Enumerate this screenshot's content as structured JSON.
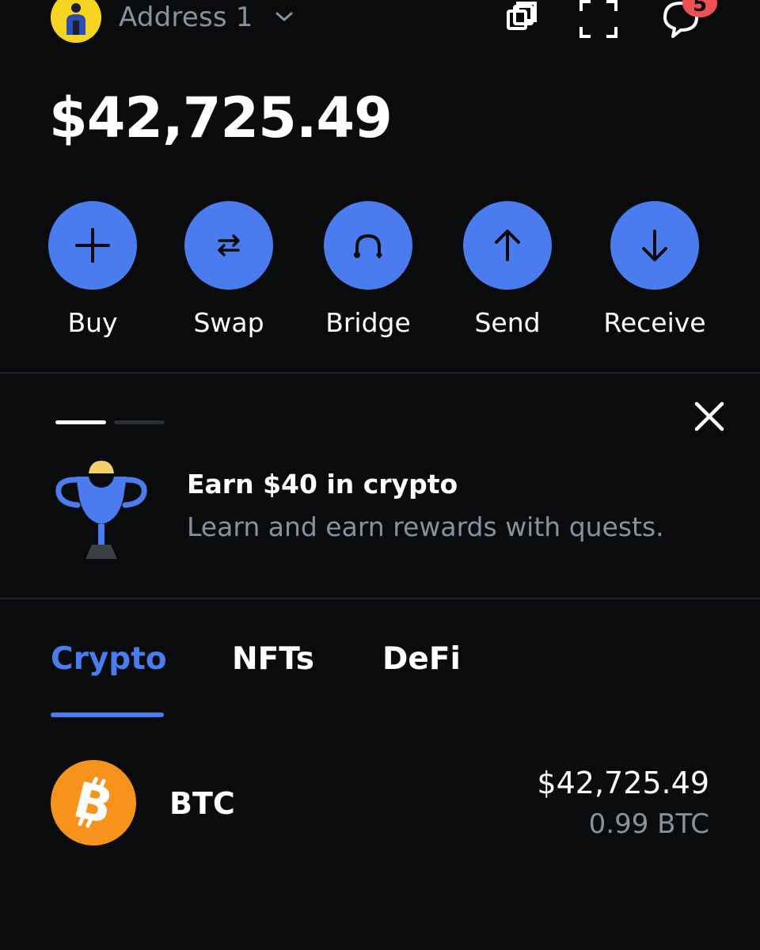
{
  "header": {
    "address_label": "Address 1",
    "avatar_icon": "account-avatar-icon",
    "chevron_icon": "chevron-down-icon",
    "copy_icon": "copy-windows-icon",
    "scan_icon": "qr-scan-icon",
    "messages_icon": "chat-bubble-icon",
    "notification_count": "5",
    "avatar_color": "#f7d322",
    "badge_color": "#f05252"
  },
  "balance": {
    "total": "$42,725.49"
  },
  "actions": [
    {
      "label": "Buy",
      "icon": "plus-icon"
    },
    {
      "label": "Swap",
      "icon": "swap-arrows-icon"
    },
    {
      "label": "Bridge",
      "icon": "bridge-icon"
    },
    {
      "label": "Send",
      "icon": "arrow-up-icon"
    },
    {
      "label": "Receive",
      "icon": "arrow-down-icon"
    }
  ],
  "promo": {
    "title": "Earn $40 in crypto",
    "subtitle": "Learn and earn rewards with quests.",
    "icon": "trophy-icon",
    "close_icon": "close-icon",
    "pager_total": 2,
    "pager_active": 1
  },
  "tabs": [
    {
      "label": "Crypto",
      "active": true
    },
    {
      "label": "NFTs",
      "active": false
    },
    {
      "label": "DeFi",
      "active": false
    }
  ],
  "assets": [
    {
      "symbol": "BTC",
      "value": "$42,725.49",
      "amount": "0.99 BTC",
      "icon": "bitcoin-icon",
      "icon_color": "#f7931a"
    }
  ],
  "colors": {
    "background": "#0a0b0d",
    "accent": "#4a7cf0",
    "muted_text": "#8a919e",
    "divider": "#22252b"
  }
}
